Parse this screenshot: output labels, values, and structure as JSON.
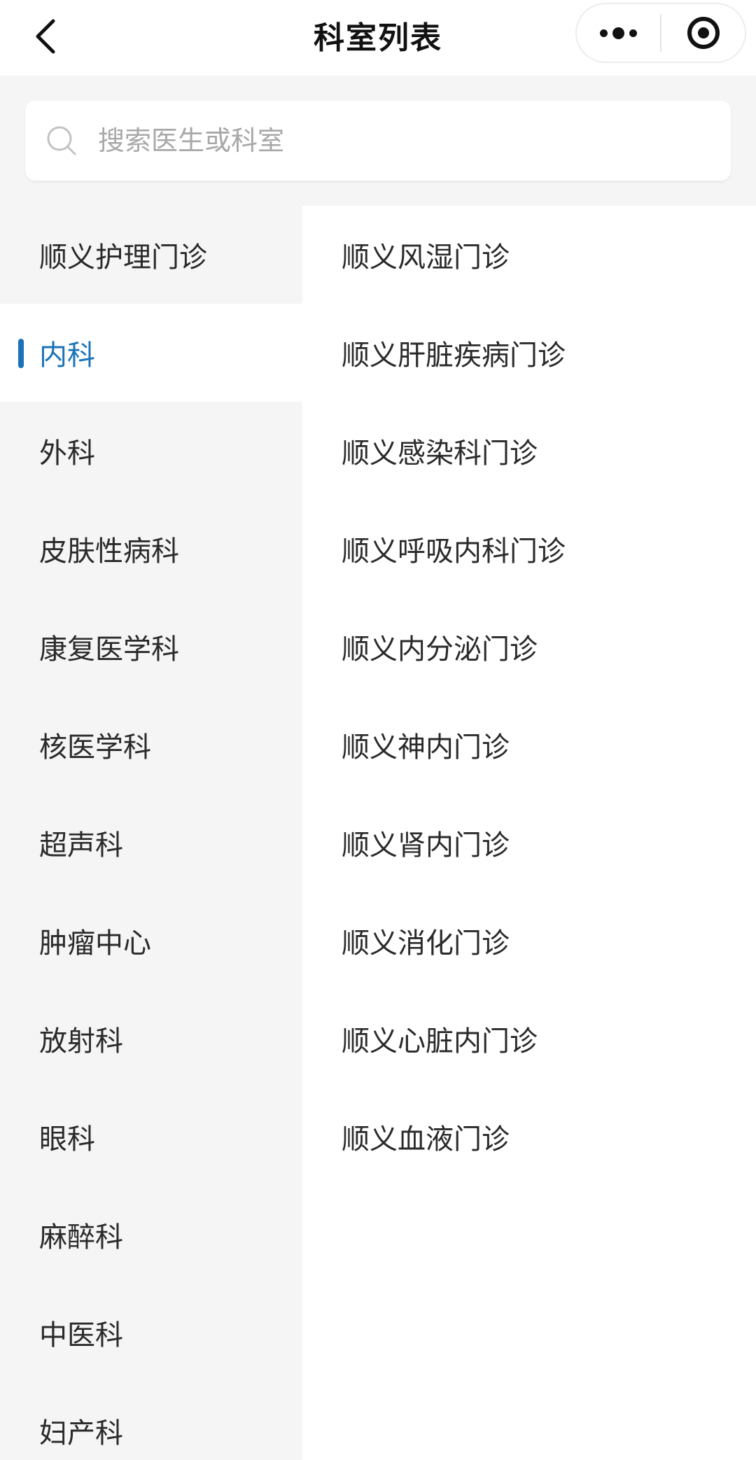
{
  "navbar": {
    "title": "科室列表",
    "back_icon": "chevron-left-icon",
    "more_icon": "more-dots-icon",
    "close_icon": "target-circle-icon"
  },
  "search": {
    "placeholder": "搜索医生或科室",
    "value": ""
  },
  "colors": {
    "accent": "#1a73b8",
    "page_bg": "#f5f5f5",
    "panel_bg": "#ffffff",
    "text": "#2a2a2a",
    "placeholder": "#a8a8a8"
  },
  "categories": [
    {
      "label": "顺义护理门诊",
      "active": false
    },
    {
      "label": "内科",
      "active": true
    },
    {
      "label": "外科",
      "active": false
    },
    {
      "label": "皮肤性病科",
      "active": false
    },
    {
      "label": "康复医学科",
      "active": false
    },
    {
      "label": "核医学科",
      "active": false
    },
    {
      "label": "超声科",
      "active": false
    },
    {
      "label": "肿瘤中心",
      "active": false
    },
    {
      "label": "放射科",
      "active": false
    },
    {
      "label": "眼科",
      "active": false
    },
    {
      "label": "麻醉科",
      "active": false
    },
    {
      "label": "中医科",
      "active": false
    },
    {
      "label": "妇产科",
      "active": false
    }
  ],
  "departments": [
    "顺义风湿门诊",
    "顺义肝脏疾病门诊",
    "顺义感染科门诊",
    "顺义呼吸内科门诊",
    "顺义内分泌门诊",
    "顺义神内门诊",
    "顺义肾内门诊",
    "顺义消化门诊",
    "顺义心脏内门诊",
    "顺义血液门诊"
  ]
}
